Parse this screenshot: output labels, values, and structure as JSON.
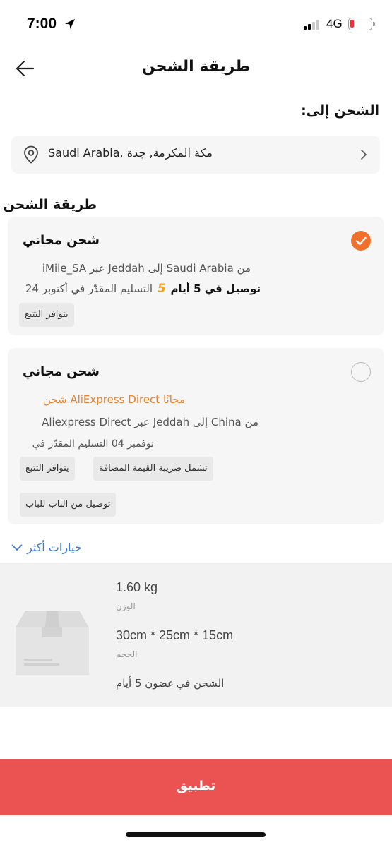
{
  "status_bar": {
    "time": "7:00",
    "network": "4G",
    "icons": [
      "location-arrow-icon",
      "signal-icon",
      "battery-icon"
    ]
  },
  "header": {
    "title": "طريقة الشحن",
    "back_icon": "back-arrow-icon"
  },
  "ship_to": {
    "label": "الشحن إلى:",
    "address": "Saudi Arabia, مكة المكرمة, جدة"
  },
  "shipping_method": {
    "label": "طريقة الشحن",
    "options": [
      {
        "title": "شحن مجاني",
        "selected": true,
        "route": "من Saudi Arabia إلى Jeddah عبر iMile_SA",
        "delivery": "أكتوبر 24 التسليم المقدّر في  توصيل في 5 أيام",
        "delivery_badge": "5",
        "tags": [
          "يتوافر التتبع"
        ]
      },
      {
        "title": "شحن مجاني",
        "selected": false,
        "price_line": "مجانًا AliExpress Direct شحن",
        "route": "من China إلى Jeddah عبر Aliexpress Direct",
        "delivery": "نوفمبر 04 التسليم المقدّر في",
        "tags": [
          "تشمل ضريبة القيمة المضافة",
          "يتوافر التتبع",
          "توصيل من الباب للباب"
        ]
      }
    ]
  },
  "more_options": "خيارات أكثر",
  "package": {
    "weight": "1.60 kg",
    "weight_label": "الوزن",
    "size": "30cm * 25cm * 15cm",
    "size_label": "الحجم",
    "shipping_days": "الشحن في غضون 5 أيام"
  },
  "apply_button": "تطبيق",
  "colors": {
    "accent": "#f2702c",
    "apply": "#eb5352",
    "link": "#3a7ad9",
    "orange_text": "#e8812a",
    "battery_low": "#e8333a"
  }
}
